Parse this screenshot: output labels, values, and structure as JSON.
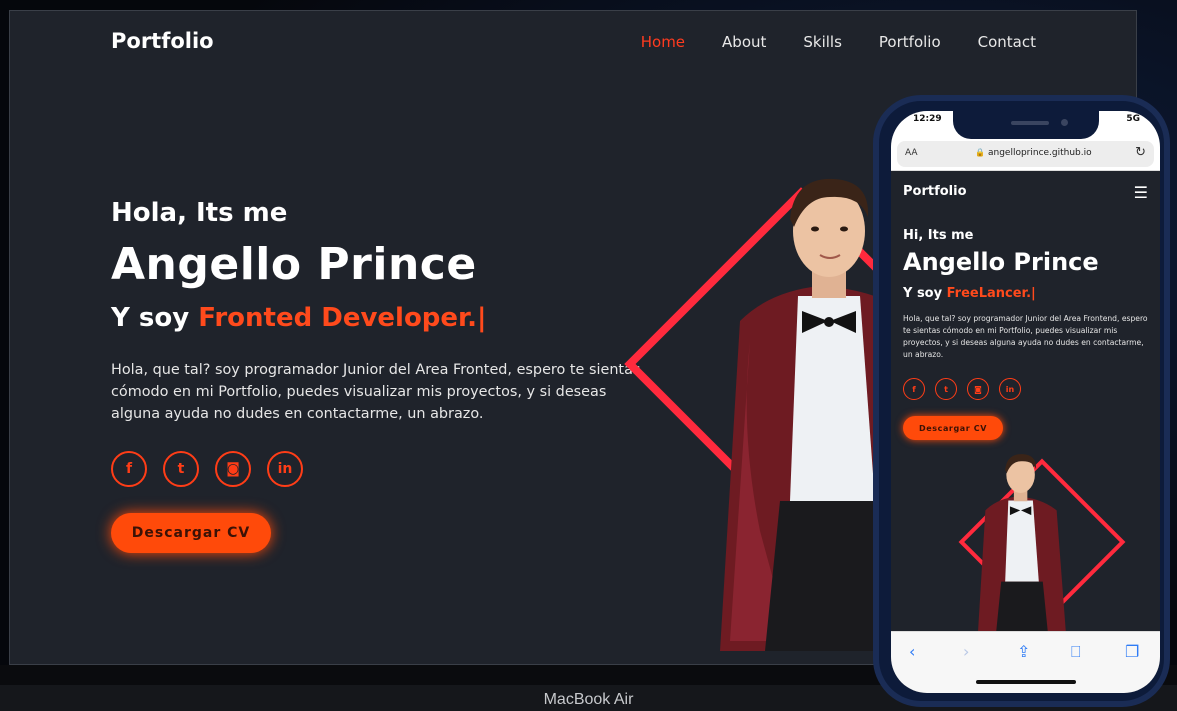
{
  "laptop": {
    "nav": {
      "logo": "Portfolio",
      "links": [
        "Home",
        "About",
        "Skills",
        "Portfolio",
        "Contact"
      ],
      "active_index": 0
    },
    "hero": {
      "greeting": "Hola, Its me",
      "name": "Angello Prince",
      "role_prefix": "Y soy ",
      "role_accent": "Fronted Developer.",
      "cursor": "|",
      "description": "Hola, que tal? soy programador Junior del Area Fronted, espero te sientas cómodo en mi Portfolio, puedes visualizar mis proyectos, y si deseas alguna ayuda no dudes en contactarme, un abrazo.",
      "socials": [
        {
          "icon": "facebook-icon",
          "glyph": "f"
        },
        {
          "icon": "twitter-icon",
          "glyph": "t"
        },
        {
          "icon": "instagram-icon",
          "glyph": "◙"
        },
        {
          "icon": "linkedin-icon",
          "glyph": "in"
        }
      ],
      "cv_button": "Descargar CV"
    },
    "base_label": "MacBook Air"
  },
  "phone": {
    "status": {
      "time": "12:29",
      "signal": "5G"
    },
    "browser": {
      "aa": "AA",
      "url": "angelloprince.github.io",
      "reload": "↻"
    },
    "nav": {
      "logo": "Portfolio",
      "menu": "☰"
    },
    "hero": {
      "greeting": "Hi, Its me",
      "name": "Angello Prince",
      "role_prefix": "Y soy ",
      "role_accent": "FreeLancer.",
      "cursor": "|",
      "description": "Hola, que tal? soy programador Junior del Area Frontend, espero te sientas cómodo en mi Portfolio, puedes visualizar mis proyectos, y si deseas alguna ayuda no dudes en contactarme, un abrazo.",
      "socials": [
        {
          "icon": "facebook-icon",
          "glyph": "f"
        },
        {
          "icon": "twitter-icon",
          "glyph": "t"
        },
        {
          "icon": "instagram-icon",
          "glyph": "◙"
        },
        {
          "icon": "linkedin-icon",
          "glyph": "in"
        }
      ],
      "cv_button": "Descargar CV"
    },
    "toolbar": {
      "back": "‹",
      "forward": "›",
      "share": "⇪",
      "bookmarks": "⎕",
      "tabs": "❐"
    }
  },
  "colors": {
    "accent": "#ff4a0a",
    "diamond": "#ff2a3d",
    "bg": "#1f232b"
  }
}
